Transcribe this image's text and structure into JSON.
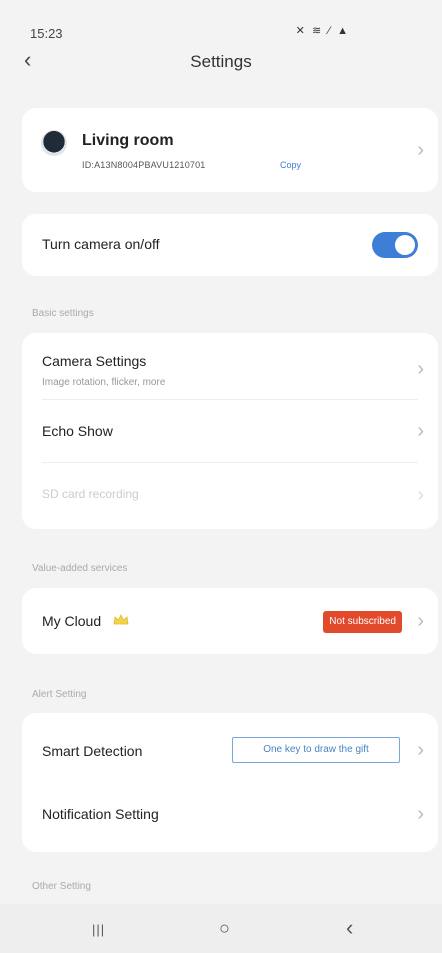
{
  "status_bar": {
    "time": "15:23",
    "icons": "✕ ≋ ⁄ ▲"
  },
  "header": {
    "back_glyph": "‹",
    "title": "Settings"
  },
  "device": {
    "name": "Living room",
    "id": "ID:A13N8004PBAVU1210701",
    "copy_label": "Copy"
  },
  "camera_toggle": {
    "label": "Turn camera on/off",
    "on": true
  },
  "sections": {
    "basic": "Basic settings",
    "value_added": "Value-added services",
    "alert": "Alert Setting",
    "other": "Other Setting"
  },
  "basic_rows": {
    "camera_settings": {
      "label": "Camera Settings",
      "subtitle": "Image rotation, flicker, more"
    },
    "echo_show": {
      "label": "Echo Show"
    },
    "sd_card": {
      "label": "SD card recording"
    }
  },
  "cloud": {
    "label": "My Cloud",
    "badge": "Not subscribed"
  },
  "alert_rows": {
    "smart_detection": {
      "label": "Smart Detection",
      "button": "One key to draw the gift"
    },
    "notification": {
      "label": "Notification Setting"
    }
  },
  "chevron_glyph": "›",
  "nav": {
    "recent": "|||",
    "home": "○",
    "back": "‹"
  },
  "colors": {
    "accent": "#3d7fd6",
    "badge": "#e24a2c",
    "background": "#f3f3f3"
  }
}
